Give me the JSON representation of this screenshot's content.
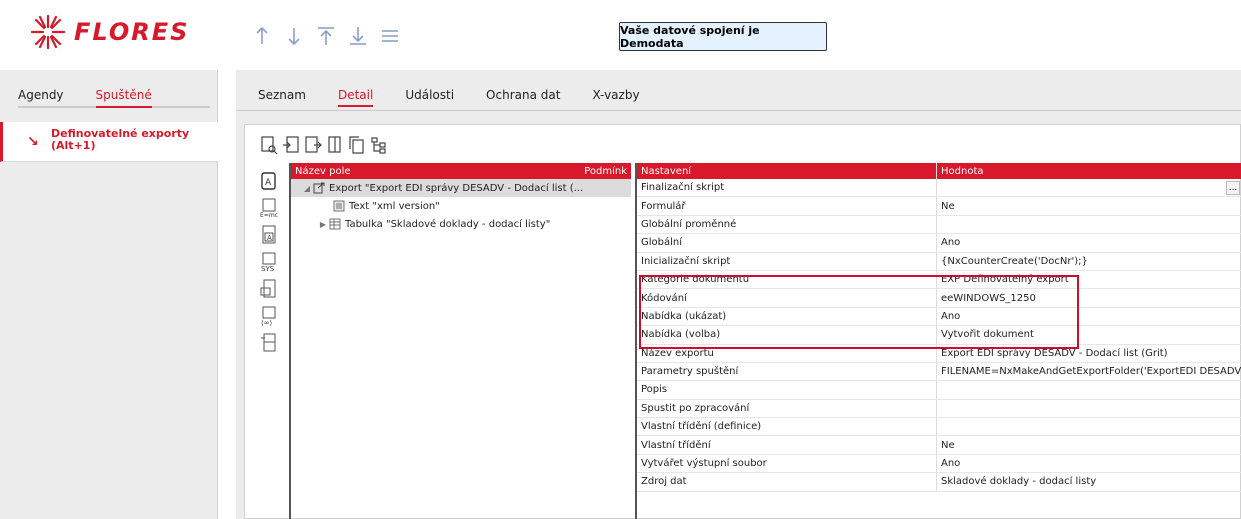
{
  "header": {
    "logo_text": "FLORES",
    "connection_text": "Vaše datové spojení je Demodata",
    "brand_color": "#d7192b"
  },
  "left": {
    "tabs": [
      {
        "label": "Agendy"
      },
      {
        "label": "Spuštěné"
      }
    ],
    "active_item": "Definovatelné exporty (Alt+1)"
  },
  "main": {
    "tabs": [
      {
        "label": "Seznam"
      },
      {
        "label": "Detail"
      },
      {
        "label": "Události"
      },
      {
        "label": "Ochrana dat"
      },
      {
        "label": "X-vazby"
      }
    ]
  },
  "tree": {
    "header_name": "Název pole",
    "header_cond": "Podmínk",
    "rows": [
      {
        "label": "Export \"Export EDI správy DESADV - Dodací list (..."
      },
      {
        "label": "Text \"xml version\""
      },
      {
        "label": "Tabulka \"Skladové doklady - dodací listy\""
      }
    ]
  },
  "grid": {
    "header_setting": "Nastavení",
    "header_value": "Hodnota",
    "rows": [
      {
        "name": "Finalizační skript",
        "value": ""
      },
      {
        "name": "Formulář",
        "value": "Ne"
      },
      {
        "name": "Globální proměnné",
        "value": ""
      },
      {
        "name": "Globální",
        "value": "Ano"
      },
      {
        "name": "Inicializační skript",
        "value": "{NxCounterCreate('DocNr');}"
      },
      {
        "name": "Kategorie dokumentu",
        "value": "EXP Definovatelný export"
      },
      {
        "name": "Kódování",
        "value": "eeWINDOWS_1250"
      },
      {
        "name": "Nabídka (ukázat)",
        "value": "Ano"
      },
      {
        "name": "Nabídka (volba)",
        "value": "Vytvořit dokument"
      },
      {
        "name": "Název exportu",
        "value": "Export EDI správy DESADV - Dodací list (Grit)"
      },
      {
        "name": "Parametry spuštění",
        "value": "FILENAME=NxMakeAndGetExportFolder('ExportEDI DESADV') -"
      },
      {
        "name": "Popis",
        "value": ""
      },
      {
        "name": "Spustit po zpracování",
        "value": ""
      },
      {
        "name": "Vlastní třídění (definice)",
        "value": ""
      },
      {
        "name": "Vlastní třídění",
        "value": "Ne"
      },
      {
        "name": "Vytvářet výstupní soubor",
        "value": "Ano"
      },
      {
        "name": "Zdroj dat",
        "value": "Skladové doklady - dodací listy"
      }
    ],
    "dots_label": "..."
  }
}
